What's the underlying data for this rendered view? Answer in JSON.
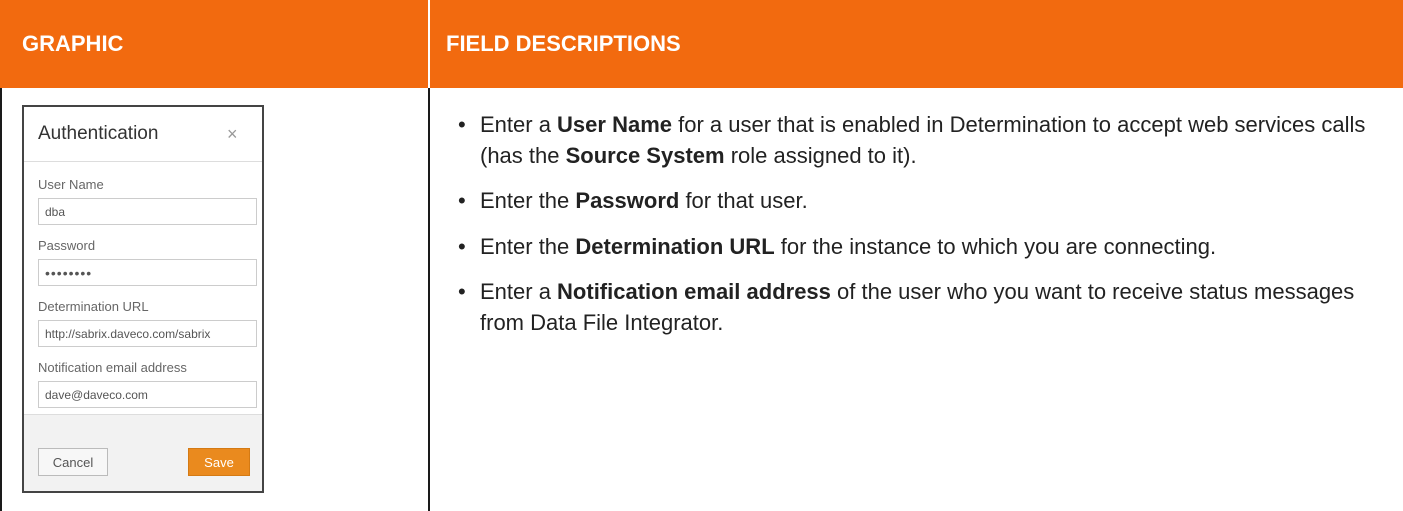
{
  "header": {
    "graphic": "GRAPHIC",
    "field_descriptions": "FIELD DESCRIPTIONS"
  },
  "dialog": {
    "title": "Authentication",
    "close_glyph": "×",
    "fields": [
      {
        "label": "User Name",
        "value": "dba"
      },
      {
        "label": "Password",
        "value": "••••••••"
      },
      {
        "label": "Determination URL",
        "value": "http://sabrix.daveco.com/sabrix"
      },
      {
        "label": "Notification email address",
        "value": "dave@daveco.com"
      }
    ],
    "cancel_label": "Cancel",
    "save_label": "Save"
  },
  "descriptions": [
    {
      "before": "Enter a ",
      "bold": "User Name",
      "middle": " for a user that is enabled in Determination to accept web services calls (has the ",
      "bold2": "Source System",
      "after": " role assigned to it)."
    },
    {
      "before": "Enter the ",
      "bold": "Password",
      "after": " for that user."
    },
    {
      "before": "Enter the ",
      "bold": "Determination URL",
      "after": " for the instance to which you are connecting."
    },
    {
      "before": "Enter a ",
      "bold": "Notification email address",
      "after": " of the user who you want to receive status messages from Data File Integrator."
    }
  ],
  "colors": {
    "header_bg": "#f26a0f",
    "save_button": "#ea8a1e"
  },
  "bullet_glyph": "•"
}
